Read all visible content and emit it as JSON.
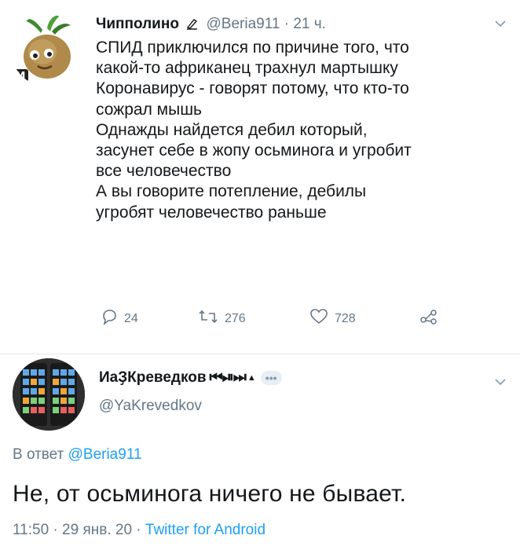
{
  "tweet": {
    "author_name": "Чипполино",
    "author_handle": "@Beria911",
    "separator": " · ",
    "time_ago": "21 ч.",
    "lines": [
      "СПИД приключился  по причине того, что",
      "какой-то африканец трахнул мартышку",
      "Коронавирус - говорят потому, что кто-то",
      "сожрал мышь",
      "Однажды найдется дебил который,",
      "засунет себе в жопу осьминога и угробит",
      "все человечество",
      "А вы говорите потепление, дебилы",
      "угробят человечество раньше"
    ],
    "replies": "24",
    "retweets": "276",
    "likes": "728"
  },
  "reply": {
    "author_name": "ИаҘКреведков",
    "name_badge": "⏮⏯⏭",
    "author_handle": "@YaKrevedkov",
    "reply_prefix": "В ответ ",
    "reply_mention": "@Beria911",
    "text": "Не, от осьминога ничего не бывает.",
    "time": "11:50",
    "date": "29 янв. 20",
    "source": "Twitter for Android",
    "separator": " · "
  },
  "icons": [
    "reply-icon",
    "retweet-icon",
    "like-icon",
    "share-icon",
    "chevron-down-icon"
  ],
  "colors": {
    "text": "#14171a",
    "muted": "#657786",
    "link": "#1da1f2",
    "divider": "#e1e8ed"
  }
}
